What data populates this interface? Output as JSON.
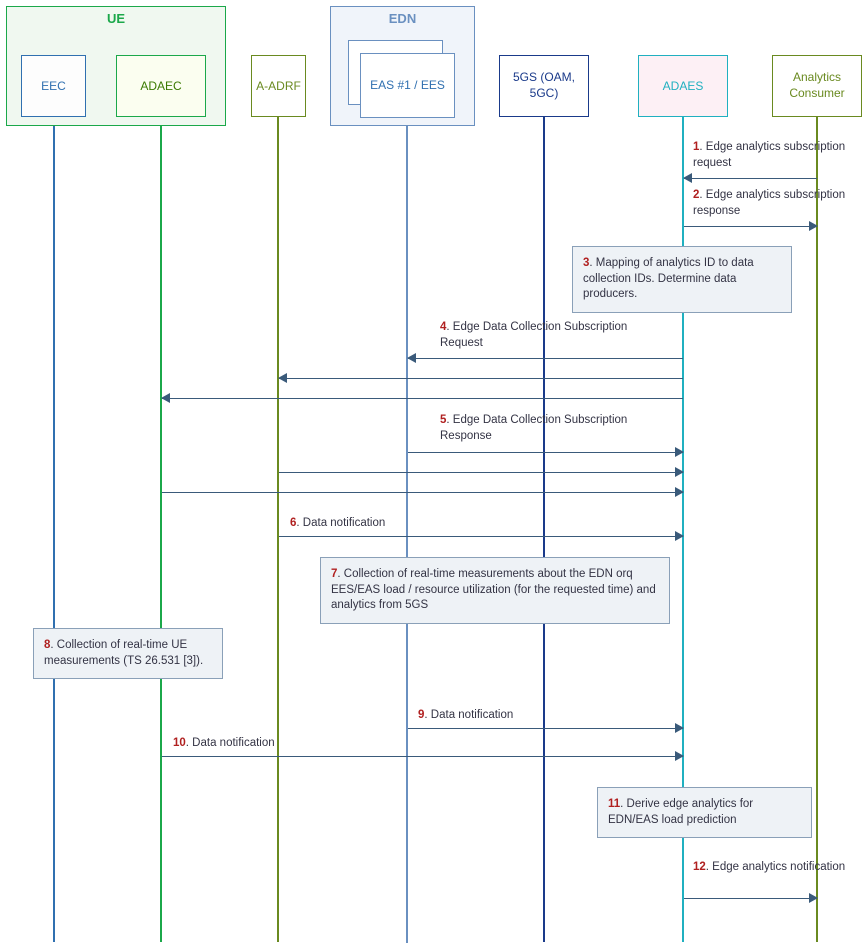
{
  "participants": {
    "ue_group": "UE",
    "eec": "EEC",
    "adaec": "ADAEC",
    "a_adrf": "A-ADRF",
    "edn_group": "EDN",
    "eas": "EAS #1 / EES",
    "fgs": "5GS (OAM, 5GC)",
    "adaes": "ADAES",
    "consumer": "Analytics Consumer"
  },
  "messages": {
    "m1_num": "1",
    "m1": ". Edge analytics subscription request",
    "m2_num": "2",
    "m2": ". Edge analytics subscription response",
    "m3_num": "3",
    "m3": ". Mapping of analytics ID to data collection IDs. Determine data producers.",
    "m4_num": "4",
    "m4": ". Edge Data Collection Subscription Request",
    "m5_num": "5",
    "m5": ". Edge Data Collection Subscription Response",
    "m6_num": "6",
    "m6": ". Data notification",
    "m7_num": "7",
    "m7": ". Collection of real-time measurements about the EDN orq EES/EAS load / resource utilization (for the requested time) and analytics from 5GS",
    "m8_num": "8",
    "m8": ". Collection of real-time UE measurements (TS 26.531 [3]).",
    "m9_num": "9",
    "m9": ". Data notification",
    "m10_num": "10",
    "m10": ". Data notification",
    "m11_num": "11",
    "m11": ". Derive edge analytics for EDN/EAS load prediction",
    "m12_num": "12",
    "m12": ". Edge analytics notification"
  }
}
